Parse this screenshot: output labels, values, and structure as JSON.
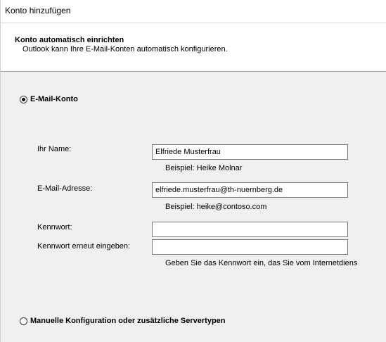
{
  "window": {
    "title": "Konto hinzufügen"
  },
  "header": {
    "title": "Konto automatisch einrichten",
    "subtitle": "Outlook kann Ihre E-Mail-Konten automatisch konfigurieren."
  },
  "options": {
    "email_account": {
      "label": "E-Mail-Konto",
      "selected": true
    },
    "manual": {
      "label": "Manuelle Konfiguration oder zusätzliche Servertypen",
      "selected": false
    }
  },
  "form": {
    "name": {
      "label": "Ihr Name:",
      "value": "Elfriede Musterfrau",
      "hint": "Beispiel: Heike Molnar"
    },
    "email": {
      "label": "E-Mail-Adresse:",
      "value": "elfriede.musterfrau@th-nuernberg.de",
      "hint": "Beispiel: heike@contoso.com"
    },
    "password": {
      "label": "Kennwort:",
      "value": ""
    },
    "password_confirm": {
      "label": "Kennwort erneut eingeben:",
      "value": "",
      "hint": "Geben Sie das Kennwort ein, das Sie vom Internetdiens"
    }
  }
}
